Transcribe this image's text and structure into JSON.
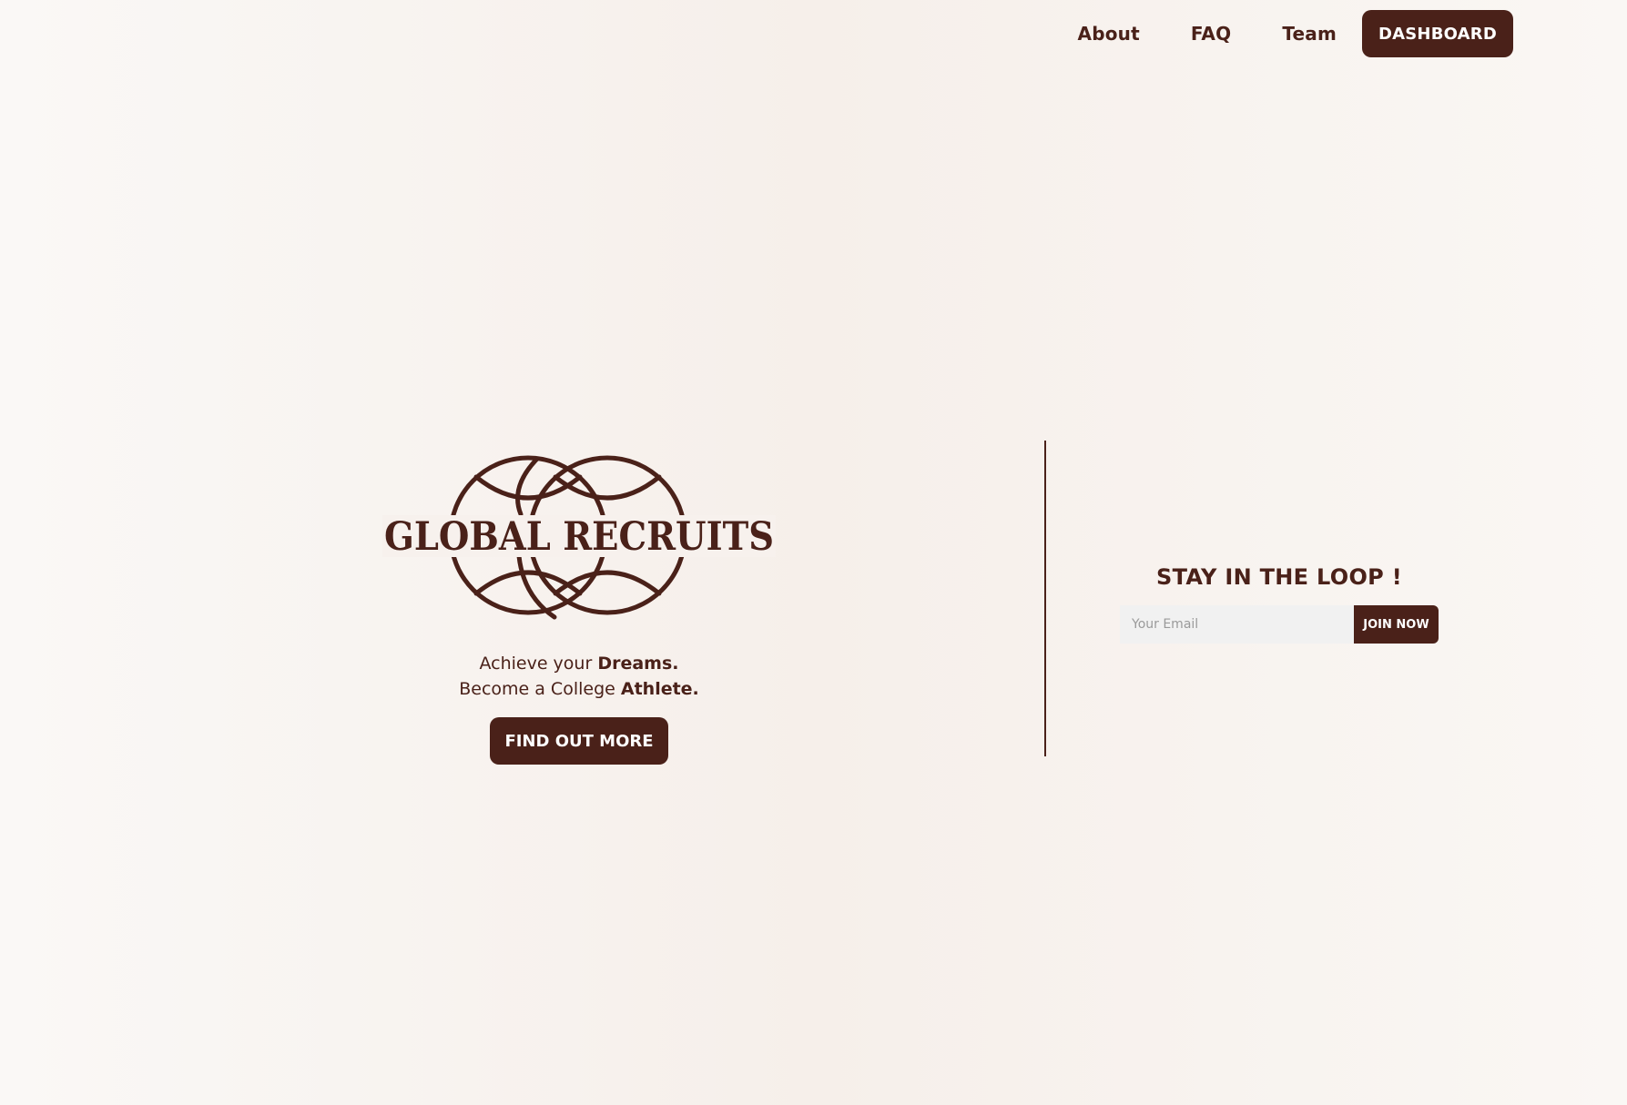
{
  "nav": {
    "about": "About",
    "faq": "FAQ",
    "team": "Team",
    "dashboard": "DASHBOARD"
  },
  "hero": {
    "logo_text": "GLOBAL RECRUITS",
    "tagline_line1_prefix": "Achieve your ",
    "tagline_line1_bold": "Dreams.",
    "tagline_line2_prefix": "Become a College ",
    "tagline_line2_bold": "Athlete.",
    "cta": "FIND OUT MORE"
  },
  "newsletter": {
    "title": "STAY IN THE LOOP !",
    "email_placeholder": "Your Email",
    "email_value": "",
    "submit": "JOIN NOW"
  },
  "colors": {
    "brand": "#4a2119",
    "background": "#f7f1ed",
    "input_bg": "#f1f1f1"
  },
  "icons": {
    "logo": "interlocking-globes-logo"
  }
}
